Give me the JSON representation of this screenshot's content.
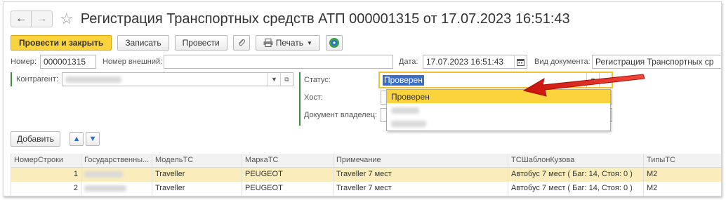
{
  "window": {
    "title": "Регистрация Транспортных средств АТП 000001315 от 17.07.2023 16:51:43"
  },
  "toolbar": {
    "post_close": "Провести и закрыть",
    "save": "Записать",
    "post": "Провести",
    "print": "Печать"
  },
  "header": {
    "number_label": "Номер:",
    "number_value": "000001315",
    "ext_number_label": "Номер внешний:",
    "ext_number_value": "",
    "date_label": "Дата:",
    "date_value": "17.07.2023 16:51:43",
    "doc_type_label": "Вид документа:",
    "doc_type_value": "Регистрация Транспортных ср"
  },
  "form": {
    "counterparty_label": "Контрагент:",
    "status_label": "Статус:",
    "status_value": "Проверен",
    "host_label": "Хост:",
    "owner_doc_label": "Документ владелец:"
  },
  "status_dropdown": {
    "options": [
      "Проверен"
    ]
  },
  "table_toolbar": {
    "add": "Добавить"
  },
  "table": {
    "columns": [
      "НомерСтроки",
      "Государственны...",
      "МодельТС",
      "МаркаТС",
      "Примечание",
      "ТСШаблонКузова",
      "ТипыТС"
    ],
    "rows": [
      {
        "num": "1",
        "model": "Traveller",
        "brand": "PEUGEOT",
        "note": "Traveller 7 мест",
        "template": "Автобус 7 мест ( Баг: 14, Стоя: 0 )",
        "type": "M2"
      },
      {
        "num": "2",
        "model": "Traveller",
        "brand": "PEUGEOT",
        "note": "Traveller 7 мест",
        "template": "Автобус 7 мест ( Баг: 14, Стоя: 0 )",
        "type": "M2"
      }
    ]
  },
  "colors": {
    "accent": "#fbd33c",
    "selection": "#3a6fc7",
    "arrow": "#e0241c"
  }
}
